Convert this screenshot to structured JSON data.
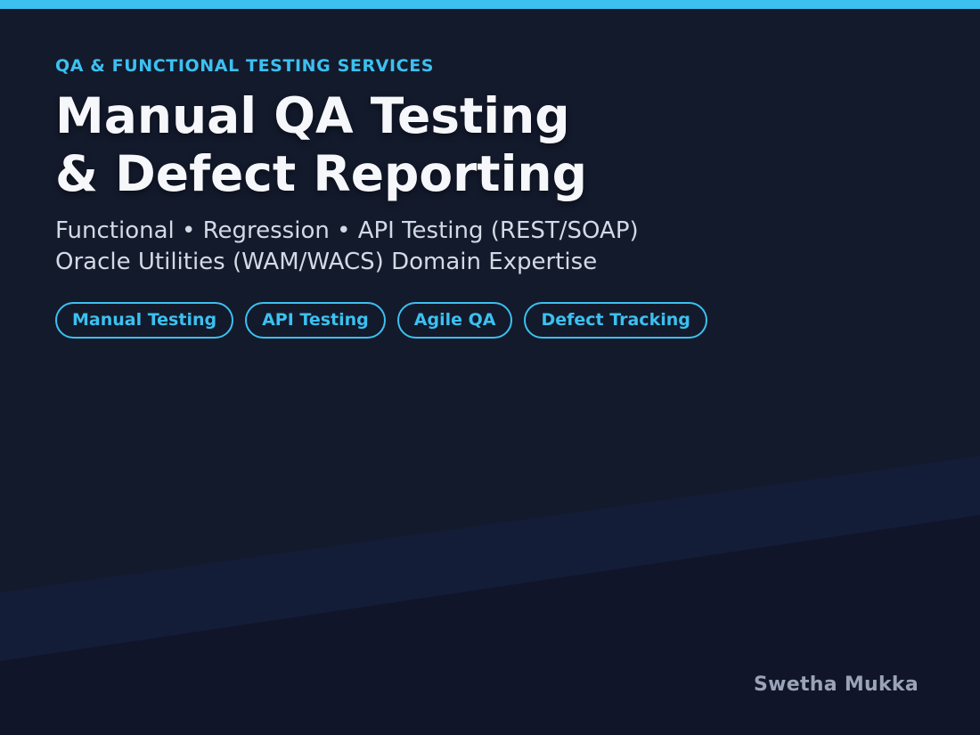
{
  "eyebrow": "QA & FUNCTIONAL TESTING SERVICES",
  "title": {
    "line1": "Manual QA Testing",
    "line2": "& Defect Reporting"
  },
  "subtitle": {
    "line1": "Functional • Regression • API Testing (REST/SOAP)",
    "line2": "Oracle Utilities (WAM/WACS) Domain Expertise"
  },
  "tags": [
    {
      "label": "Manual Testing"
    },
    {
      "label": "API Testing"
    },
    {
      "label": "Agile QA"
    },
    {
      "label": "Defect Tracking"
    }
  ],
  "author": "Swetha Mukka",
  "colors": {
    "accent": "#3cc0f0",
    "background": "#131a2c",
    "title": "#f6f7fb",
    "subtitle": "#d4d9e6",
    "author": "#9aa3b8"
  }
}
